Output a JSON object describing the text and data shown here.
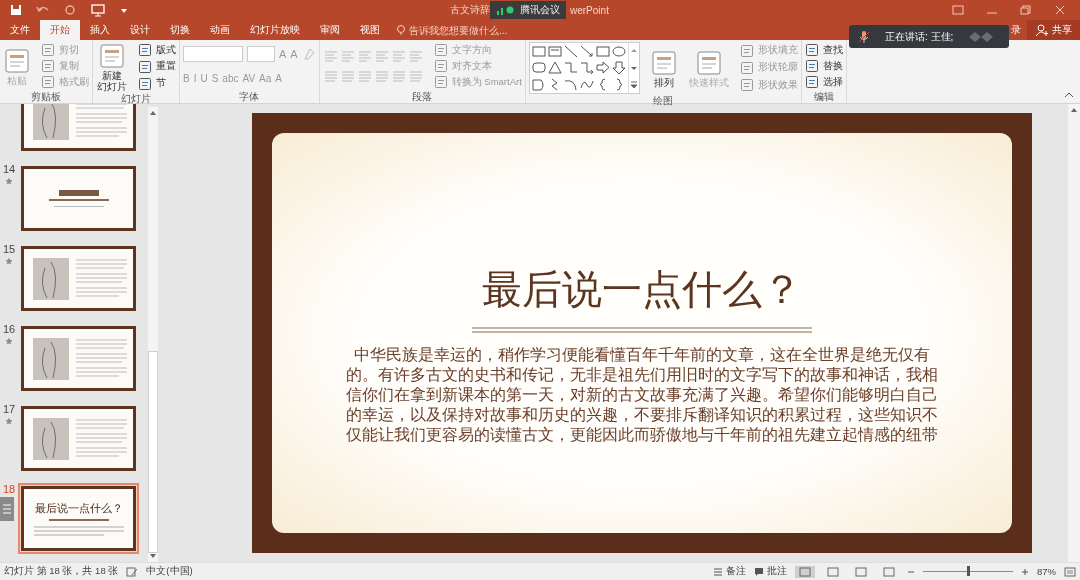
{
  "title_bar": {
    "title": "古文诗辞",
    "title_tail": "werPoint"
  },
  "meeting_badge": {
    "label": "腾讯会议"
  },
  "tabs": [
    {
      "label": "文件",
      "selected": false
    },
    {
      "label": "开始",
      "selected": true
    },
    {
      "label": "插入",
      "selected": false
    },
    {
      "label": "设计",
      "selected": false
    },
    {
      "label": "切换",
      "selected": false
    },
    {
      "label": "动画",
      "selected": false
    },
    {
      "label": "幻灯片放映",
      "selected": false
    },
    {
      "label": "审阅",
      "selected": false
    },
    {
      "label": "视图",
      "selected": false
    }
  ],
  "tell_me": {
    "placeholder": "告诉我您想要做什么..."
  },
  "account": {
    "label": "录"
  },
  "share_button": {
    "label": "共享"
  },
  "speaker_banner": {
    "text": "正在讲话: 王佳;"
  },
  "ribbon": {
    "groups": [
      {
        "label": "剪贴板",
        "columns": [
          {
            "items": [
              {
                "kind": "large",
                "label": "粘贴",
                "disabled": true
              }
            ]
          },
          {
            "items": [
              {
                "kind": "small",
                "label": "剪切",
                "disabled": true
              },
              {
                "kind": "small",
                "label": "复制",
                "disabled": true
              },
              {
                "kind": "small",
                "label": "格式刷",
                "disabled": true
              }
            ]
          }
        ]
      },
      {
        "label": "幻灯片",
        "columns": [
          {
            "items": [
              {
                "kind": "large",
                "lines": [
                  "新建",
                  "幻灯片"
                ],
                "disabled": false
              }
            ]
          },
          {
            "items": [
              {
                "kind": "small",
                "label": "版式",
                "disabled": false
              },
              {
                "kind": "small",
                "label": "重置",
                "disabled": false
              },
              {
                "kind": "small",
                "label": "节",
                "disabled": false
              }
            ]
          }
        ]
      },
      {
        "label": "字体",
        "columns": [
          {
            "items": [
              {
                "kind": "combo-row",
                "glyphs": [
                  "A",
                  "A"
                ]
              },
              {
                "kind": "glyph-row",
                "glyphs": [
                  "B",
                  "I",
                  "U",
                  "S",
                  "abc",
                  "AV",
                  "Aa",
                  "A"
                ]
              }
            ]
          }
        ]
      },
      {
        "label": "段落",
        "columns": [
          {
            "items": [
              {
                "kind": "para-icons"
              }
            ]
          },
          {
            "items": [
              {
                "kind": "small",
                "label": "文字方向",
                "disabled": true
              },
              {
                "kind": "small",
                "label": "对齐文本",
                "disabled": true
              },
              {
                "kind": "small",
                "label": "转换为 SmartArt",
                "disabled": true
              }
            ]
          }
        ]
      },
      {
        "label": "绘图",
        "columns": [
          {
            "items": [
              {
                "kind": "shape-gallery"
              }
            ]
          },
          {
            "items": [
              {
                "kind": "large",
                "label": "排列",
                "disabled": false
              }
            ]
          },
          {
            "items": [
              {
                "kind": "large",
                "label": "快速样式",
                "disabled": true
              }
            ]
          },
          {
            "items": [
              {
                "kind": "small",
                "label": "形状填充",
                "disabled": true
              },
              {
                "kind": "small",
                "label": "形状轮廓",
                "disabled": true
              },
              {
                "kind": "small",
                "label": "形状效果",
                "disabled": true
              }
            ]
          }
        ]
      },
      {
        "label": "编辑",
        "columns": [
          {
            "items": [
              {
                "kind": "small",
                "label": "查找",
                "disabled": false
              },
              {
                "kind": "small",
                "label": "替换",
                "disabled": false
              },
              {
                "kind": "small",
                "label": "选择",
                "disabled": false
              }
            ]
          }
        ]
      }
    ]
  },
  "thumbnails": [
    {
      "kind": "text-image",
      "animated": false,
      "selected": false
    },
    {
      "number": "14",
      "kind": "title",
      "animated": true,
      "selected": false
    },
    {
      "number": "15",
      "kind": "text-image",
      "animated": true,
      "selected": false
    },
    {
      "number": "16",
      "kind": "text-image",
      "animated": true,
      "selected": false
    },
    {
      "number": "17",
      "kind": "text-image",
      "animated": true,
      "selected": false
    },
    {
      "number": "18",
      "kind": "title",
      "title": "最后说一点什么？",
      "animated": false,
      "selected": true
    }
  ],
  "slide": {
    "title": "最后说一点什么？",
    "body": "中华民族是幸运的，稍作学习便能看懂百年千年前的文章，这在全世界是绝无仅有的。有许多古文的史书和传记，无非是祖先们用旧时的文字写下的故事和神话，我相信你们在拿到新课本的第一天，对新的古文故事充满了兴趣。希望你们能够明白自己的幸运，以及保持对故事和历史的兴趣，不要排斥翻译知识的积累过程，这些知识不仅能让我们更容易的读懂古文，更能因此而骄傲地与千年前的祖先建立起情感的纽带"
  },
  "status_bar": {
    "slide_info": "幻灯片 第 18 张，共 18 张",
    "language": "中文(中国)",
    "notes": "备注",
    "comments": "批注",
    "views": [
      {
        "selected": true
      },
      {
        "selected": false
      },
      {
        "selected": false
      },
      {
        "selected": false
      }
    ],
    "zoom": {
      "level": 0.5,
      "reading": "87%"
    }
  }
}
